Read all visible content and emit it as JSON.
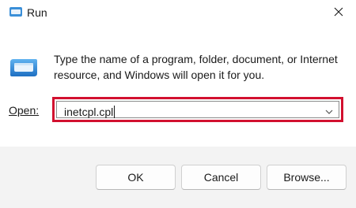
{
  "window": {
    "title": "Run",
    "close_icon": "close-icon",
    "app_icon": "run-icon"
  },
  "dialog": {
    "description": "Type the name of a program, folder, document, or Internet resource, and Windows will open it for you.",
    "open_label": "Open:",
    "open_value": "inetcpl.cpl",
    "highlight_color": "#d2102f"
  },
  "buttons": {
    "ok": "OK",
    "cancel": "Cancel",
    "browse": "Browse..."
  }
}
